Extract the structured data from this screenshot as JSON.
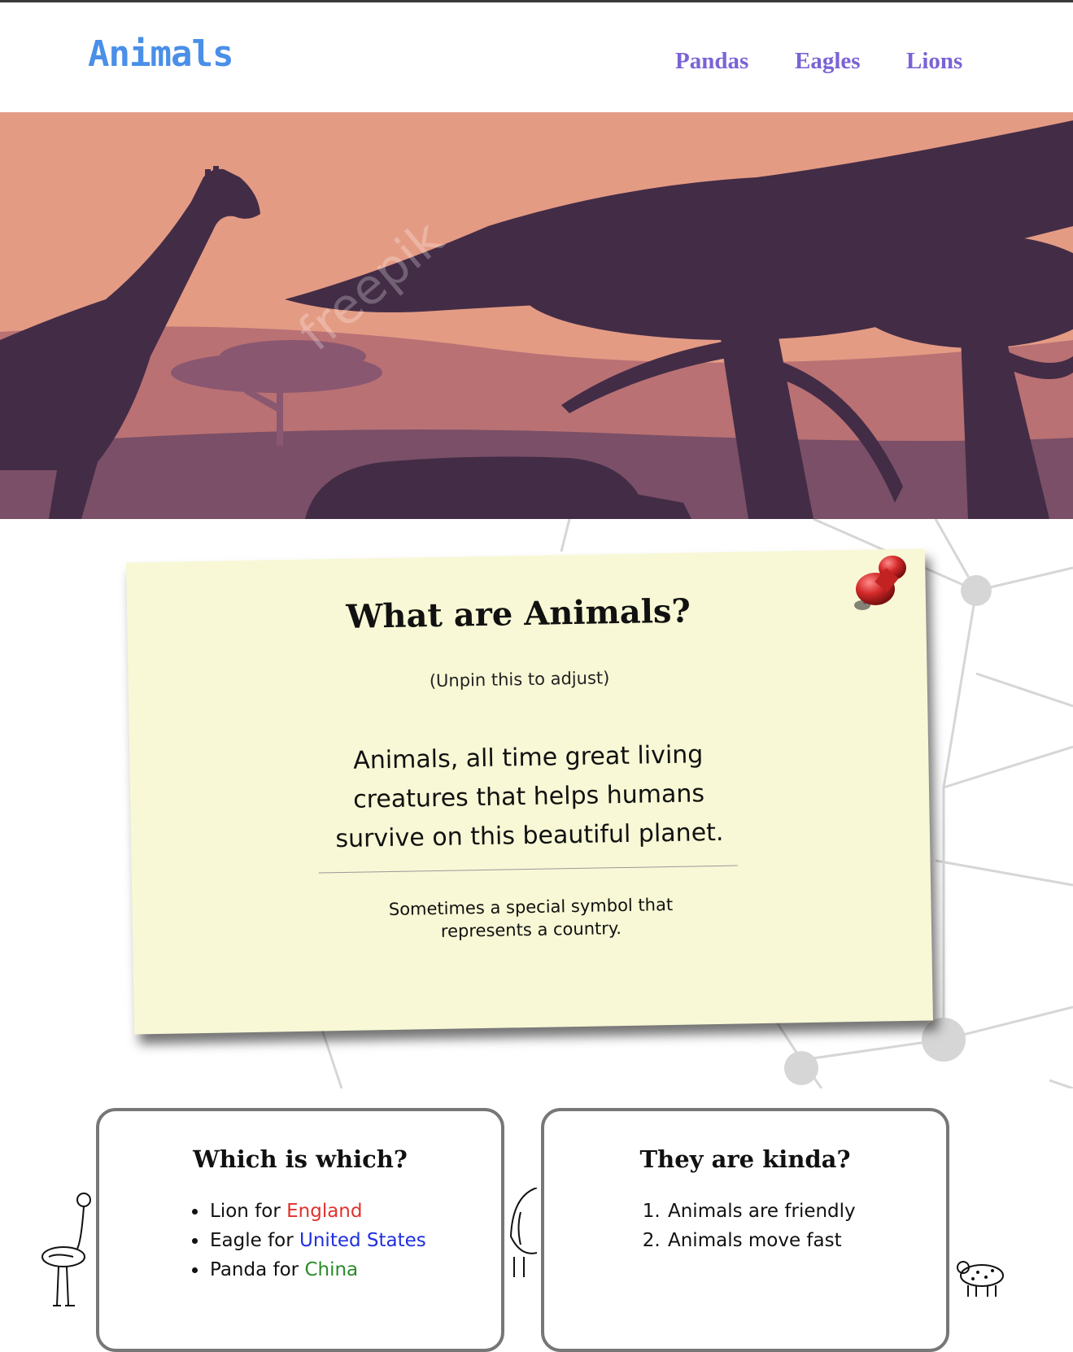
{
  "header": {
    "logo": "Animals",
    "nav": [
      "Pandas",
      "Eagles",
      "Lions"
    ]
  },
  "hero": {
    "watermark": "freepik"
  },
  "note": {
    "title": "What are Animals?",
    "hint": "(Unpin this to adjust)",
    "lead": "Animals, all time great living creatures that helps humans survive on this beautiful planet.",
    "sub": "Sometimes a special symbol that represents a country."
  },
  "card_left": {
    "title": "Which is which?",
    "items": [
      {
        "prefix": "Lion for ",
        "country": "England",
        "color": "#e0322d"
      },
      {
        "prefix": "Eagle for ",
        "country": "United States",
        "color": "#1f2fe0"
      },
      {
        "prefix": "Panda for ",
        "country": "China",
        "color": "#2a8a2a"
      }
    ]
  },
  "card_right": {
    "title": "They are kinda?",
    "items": [
      "Animals are friendly",
      "Animals move fast"
    ]
  },
  "colors": {
    "logo": "#4a8fe8",
    "nav": "#7b63d6",
    "sky": "#e49b84",
    "silhouette": "#432c46",
    "note_bg": "#f8f8d6"
  }
}
